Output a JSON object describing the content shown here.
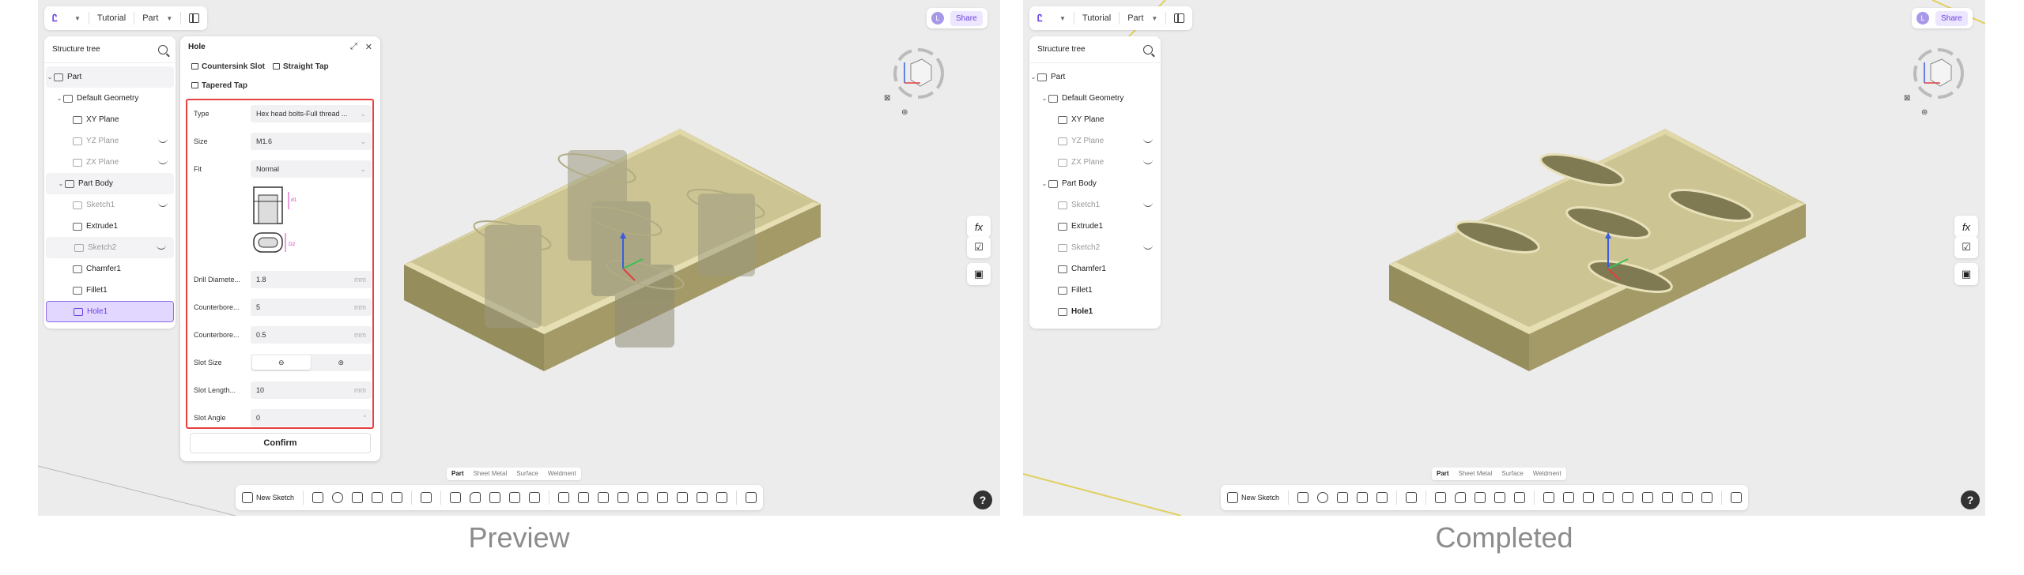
{
  "captions": {
    "left": "Preview",
    "right": "Completed"
  },
  "topbar": {
    "logo": "",
    "project": "Tutorial",
    "mode": "Part"
  },
  "topright": {
    "avatar": "L",
    "share": "Share"
  },
  "tree": {
    "title": "Structure tree",
    "items": [
      {
        "label": "Part"
      },
      {
        "label": "Default Geometry"
      },
      {
        "label": "XY Plane"
      },
      {
        "label": "YZ Plane"
      },
      {
        "label": "ZX Plane"
      },
      {
        "label": "Part Body"
      },
      {
        "label": "Sketch1"
      },
      {
        "label": "Extrude1"
      },
      {
        "label": "Sketch2"
      },
      {
        "label": "Chamfer1"
      },
      {
        "label": "Fillet1"
      },
      {
        "label": "Hole1"
      }
    ]
  },
  "dialog": {
    "title": "Hole",
    "chips": [
      "Countersink Slot",
      "Straight Tap",
      "Tapered Tap"
    ],
    "fields": {
      "type": {
        "label": "Type",
        "value": "Hex head bolts-Full thread ..."
      },
      "size": {
        "label": "Size",
        "value": "M1.6"
      },
      "fit": {
        "label": "Fit",
        "value": "Normal"
      },
      "drill": {
        "label": "Drill Diamete...",
        "value": "1.8",
        "unit": "mm"
      },
      "cb1": {
        "label": "Counterbore...",
        "value": "5",
        "unit": "mm"
      },
      "cb2": {
        "label": "Counterbore...",
        "value": "0.5",
        "unit": "mm"
      },
      "slot_size": {
        "label": "Slot Size"
      },
      "slot_length": {
        "label": "Slot Length...",
        "value": "10",
        "unit": "mm"
      },
      "slot_angle": {
        "label": "Slot Angle",
        "value": "0",
        "unit": "°"
      }
    },
    "diagram_labels": {
      "d1": "d1",
      "d2": "D2"
    },
    "confirm": "Confirm"
  },
  "side_tools": {
    "fx": "fx"
  },
  "mode_tabs": [
    "Part",
    "Sheet Metal",
    "Surface",
    "Weldment"
  ],
  "toolbar": {
    "new_sketch": "New Sketch"
  },
  "help": "?",
  "colors": {
    "accent": "#6b3fe0",
    "highlight": "#e84040",
    "body_top": "#cfc695",
    "body_side": "#8f8858"
  }
}
